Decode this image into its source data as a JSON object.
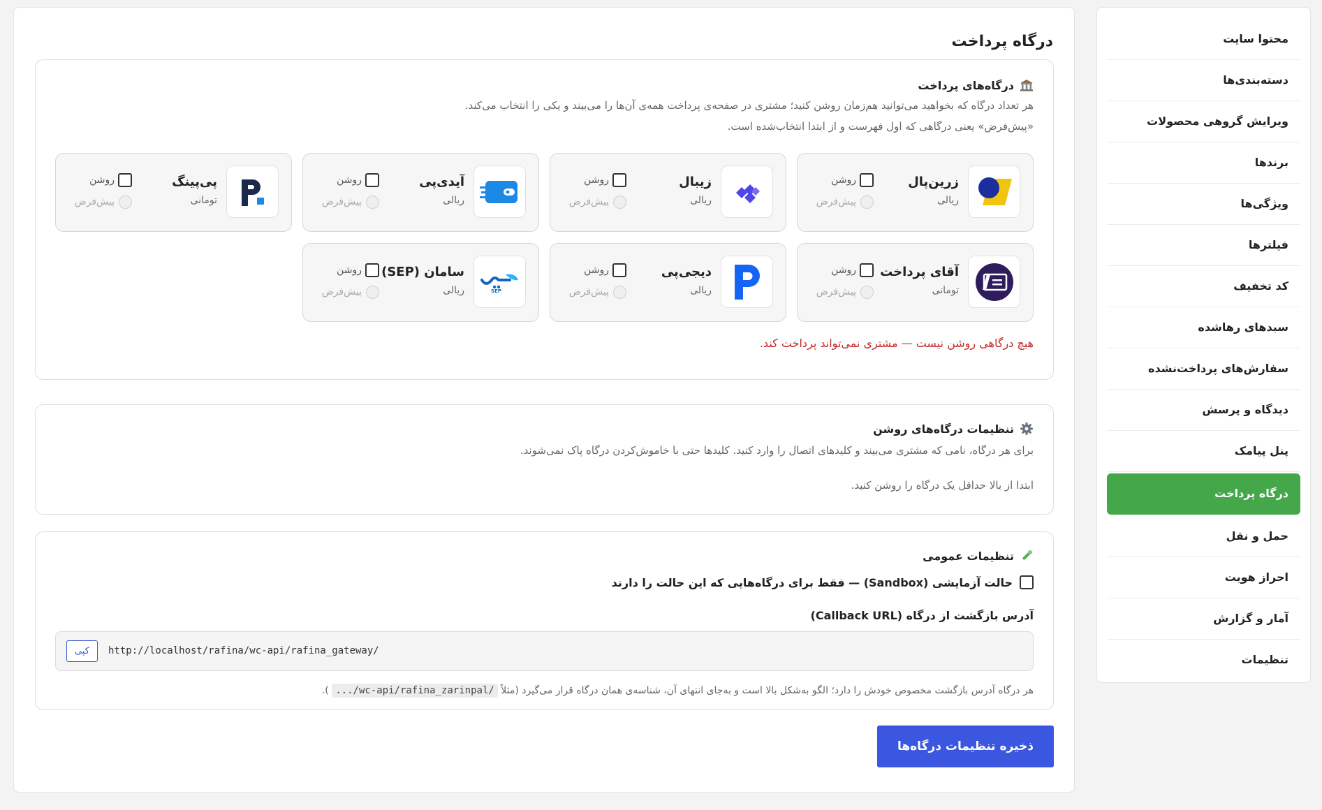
{
  "sidebar": {
    "items": [
      {
        "label": "محتوا سایت",
        "active": false
      },
      {
        "label": "دسته‌بندی‌ها",
        "active": false
      },
      {
        "label": "ویرایش گروهی محصولات",
        "active": false
      },
      {
        "label": "برندها",
        "active": false
      },
      {
        "label": "ویژگی‌ها",
        "active": false
      },
      {
        "label": "فیلترها",
        "active": false
      },
      {
        "label": "کد تخفیف",
        "active": false
      },
      {
        "label": "سبدهای رهاشده",
        "active": false
      },
      {
        "label": "سفارش‌های پرداخت‌نشده",
        "active": false
      },
      {
        "label": "دیدگاه و پرسش",
        "active": false
      },
      {
        "label": "پنل پیامک",
        "active": false
      },
      {
        "label": "درگاه پرداخت",
        "active": true
      },
      {
        "label": "حمل و نقل",
        "active": false
      },
      {
        "label": "احراز هویت",
        "active": false
      },
      {
        "label": "آمار و گزارش",
        "active": false
      },
      {
        "label": "تنظیمات",
        "active": false
      }
    ],
    "active_color": "#44a84b"
  },
  "page": {
    "title": "درگاه پرداخت"
  },
  "gateways_card": {
    "title": "درگاه‌های پرداخت",
    "icon": "bank-icon",
    "desc_line1": "هر تعداد درگاه که بخواهید می‌توانید هم‌زمان روشن کنید؛ مشتری در صفحه‌ی پرداخت همه‌ی آن‌ها را می‌بیند و یکی را انتخاب می‌کند.",
    "desc_line2": "«پیش‌فرض» یعنی درگاهی که اول فهرست و از ابتدا انتخاب‌شده است.",
    "on_label": "روشن",
    "default_label": "پیش‌فرض",
    "gateways": [
      {
        "name": "زرین‌پال",
        "currency": "ریالی",
        "logo": "zarinpal-logo",
        "enabled": false,
        "default": false
      },
      {
        "name": "زیبال",
        "currency": "ریالی",
        "logo": "zibal-logo",
        "enabled": false,
        "default": false
      },
      {
        "name": "آیدی‌پی",
        "currency": "ریالی",
        "logo": "idpay-logo",
        "enabled": false,
        "default": false
      },
      {
        "name": "پی‌پینگ",
        "currency": "تومانی",
        "logo": "payping-logo",
        "enabled": false,
        "default": false
      },
      {
        "name": "آقای پرداخت",
        "currency": "تومانی",
        "logo": "aqayepardakht-logo",
        "enabled": false,
        "default": false
      },
      {
        "name": "دیجی‌پی",
        "currency": "ریالی",
        "logo": "digipay-logo",
        "enabled": false,
        "default": false
      },
      {
        "name": "سامان (SEP)",
        "currency": "ریالی",
        "logo": "sep-logo",
        "enabled": false,
        "default": false
      }
    ],
    "warning": "هیچ درگاهی روشن نیست — مشتری نمی‌تواند پرداخت کند.",
    "warning_color": "#c62828"
  },
  "enabled_settings_card": {
    "title": "تنظیمات درگاه‌های روشن",
    "icon": "gear-icon",
    "desc": "برای هر درگاه، نامی که مشتری می‌بیند و کلیدهای اتصال را وارد کنید. کلیدها حتی با خاموش‌کردن درگاه پاک نمی‌شوند.",
    "empty_msg": "ابتدا از بالا حداقل یک درگاه را روشن کنید."
  },
  "general_card": {
    "title": "تنظیمات عمومی",
    "icon": "wrench-icon",
    "sandbox_label": "حالت آزمایشی (Sandbox) — فقط برای درگاه‌هایی که این حالت را دارند",
    "sandbox_checked": false,
    "callback_label": "آدرس بازگشت از درگاه (Callback URL)",
    "callback_url": "http://localhost/rafina/wc-api/rafina_gateway/",
    "copy_label": "کپی",
    "note_prefix": "هر درگاه آدرس بازگشت مخصوص خودش را دارد؛ الگو به‌شکل بالا است و به‌جای انتهای آن، شناسه‌ی همان درگاه قرار می‌گیرد (مثلاً",
    "note_code": ".../wc-api/rafina_zarinpal/",
    "note_suffix": ")."
  },
  "save_button": {
    "label": "ذخیره تنظیمات درگاه‌ها",
    "color": "#3b57e0"
  }
}
